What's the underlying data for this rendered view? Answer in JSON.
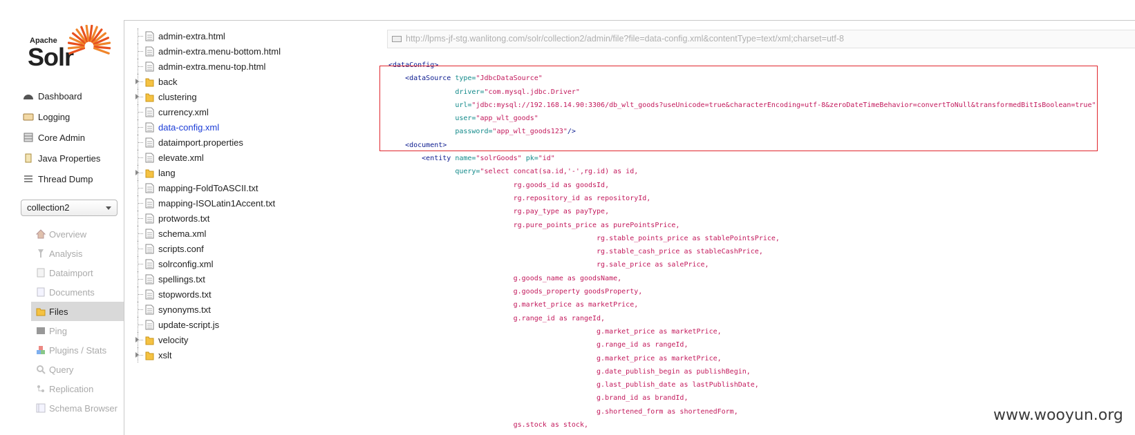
{
  "logo": {
    "apache": "Apache",
    "solr": "Solr"
  },
  "nav": [
    {
      "label": "Dashboard",
      "icon": "dashboard-icon"
    },
    {
      "label": "Logging",
      "icon": "logging-icon"
    },
    {
      "label": "Core Admin",
      "icon": "core-admin-icon"
    },
    {
      "label": "Java Properties",
      "icon": "java-properties-icon"
    },
    {
      "label": "Thread Dump",
      "icon": "thread-dump-icon"
    }
  ],
  "core_selector": {
    "value": "collection2"
  },
  "core_menu": [
    {
      "label": "Overview",
      "icon": "overview-icon"
    },
    {
      "label": "Analysis",
      "icon": "analysis-icon"
    },
    {
      "label": "Dataimport",
      "icon": "dataimport-icon"
    },
    {
      "label": "Documents",
      "icon": "documents-icon"
    },
    {
      "label": "Files",
      "icon": "files-icon",
      "active": true
    },
    {
      "label": "Ping",
      "icon": "ping-icon"
    },
    {
      "label": "Plugins / Stats",
      "icon": "plugins-icon"
    },
    {
      "label": "Query",
      "icon": "query-icon"
    },
    {
      "label": "Replication",
      "icon": "replication-icon"
    },
    {
      "label": "Schema Browser",
      "icon": "schema-browser-icon"
    }
  ],
  "files": [
    {
      "name": "admin-extra.html",
      "type": "file"
    },
    {
      "name": "admin-extra.menu-bottom.html",
      "type": "file"
    },
    {
      "name": "admin-extra.menu-top.html",
      "type": "file"
    },
    {
      "name": "back",
      "type": "folder"
    },
    {
      "name": "clustering",
      "type": "folder"
    },
    {
      "name": "currency.xml",
      "type": "file"
    },
    {
      "name": "data-config.xml",
      "type": "file",
      "selected": true
    },
    {
      "name": "dataimport.properties",
      "type": "file"
    },
    {
      "name": "elevate.xml",
      "type": "file"
    },
    {
      "name": "lang",
      "type": "folder"
    },
    {
      "name": "mapping-FoldToASCII.txt",
      "type": "file"
    },
    {
      "name": "mapping-ISOLatin1Accent.txt",
      "type": "file"
    },
    {
      "name": "protwords.txt",
      "type": "file"
    },
    {
      "name": "schema.xml",
      "type": "file"
    },
    {
      "name": "scripts.conf",
      "type": "file"
    },
    {
      "name": "solrconfig.xml",
      "type": "file"
    },
    {
      "name": "spellings.txt",
      "type": "file"
    },
    {
      "name": "stopwords.txt",
      "type": "file"
    },
    {
      "name": "synonyms.txt",
      "type": "file"
    },
    {
      "name": "update-script.js",
      "type": "file"
    },
    {
      "name": "velocity",
      "type": "folder"
    },
    {
      "name": "xslt",
      "type": "folder"
    }
  ],
  "url": "http://lpms-jf-stg.wanlitong.com/solr/collection2/admin/file?file=data-config.xml&contentType=text/xml;charset=utf-8",
  "code_lines": [
    [
      {
        "t": "tag",
        "v": "<dataConfig>"
      }
    ],
    [
      {
        "t": "tag",
        "v": "    <dataSource "
      },
      {
        "t": "attr",
        "v": "type="
      },
      {
        "t": "val",
        "v": "\"JdbcDataSource\""
      }
    ],
    [
      {
        "t": "attr",
        "v": "                driver="
      },
      {
        "t": "val",
        "v": "\"com.mysql.jdbc.Driver\""
      }
    ],
    [
      {
        "t": "attr",
        "v": "                url="
      },
      {
        "t": "val",
        "v": "\"jdbc:mysql://192.168.14.90:3306/db_wlt_goods?useUnicode=true&characterEncoding=utf-8&zeroDateTimeBehavior=convertToNull&transformedBitIsBoolean=true\""
      }
    ],
    [
      {
        "t": "attr",
        "v": "                user="
      },
      {
        "t": "val",
        "v": "\"app_wlt_goods\""
      }
    ],
    [
      {
        "t": "attr",
        "v": "                password="
      },
      {
        "t": "val",
        "v": "\"app_wlt_goods123\""
      },
      {
        "t": "tag",
        "v": "/>"
      }
    ],
    [
      {
        "t": "tag",
        "v": "    <document>"
      }
    ],
    [
      {
        "t": "tag",
        "v": "        <entity "
      },
      {
        "t": "attr",
        "v": "name="
      },
      {
        "t": "val",
        "v": "\"solrGoods\" "
      },
      {
        "t": "attr",
        "v": "pk="
      },
      {
        "t": "val",
        "v": "\"id\""
      }
    ],
    [
      {
        "t": "attr",
        "v": "                query="
      },
      {
        "t": "val",
        "v": "\"select concat(sa.id,'-',rg.id) as id,"
      }
    ],
    [
      {
        "t": "txt",
        "v": "                              rg.goods_id as goodsId,"
      }
    ],
    [
      {
        "t": "txt",
        "v": "                              rg.repository_id as repositoryId,"
      }
    ],
    [
      {
        "t": "txt",
        "v": "                              rg.pay_type as payType,"
      }
    ],
    [
      {
        "t": "txt",
        "v": "                              rg.pure_points_price as purePointsPrice,"
      }
    ],
    [
      {
        "t": "txt",
        "v": "                                                  rg.stable_points_price as stablePointsPrice,"
      }
    ],
    [
      {
        "t": "txt",
        "v": "                                                  rg.stable_cash_price as stableCashPrice,"
      }
    ],
    [
      {
        "t": "txt",
        "v": "                                                  rg.sale_price as salePrice,"
      }
    ],
    [
      {
        "t": "txt",
        "v": "                              g.goods_name as goodsName,"
      }
    ],
    [
      {
        "t": "txt",
        "v": "                              g.goods_property goodsProperty,"
      }
    ],
    [
      {
        "t": "txt",
        "v": "                              g.market_price as marketPrice,"
      }
    ],
    [
      {
        "t": "txt",
        "v": "                              g.range_id as rangeId,"
      }
    ],
    [
      {
        "t": "txt",
        "v": "                                                  g.market_price as marketPrice,"
      }
    ],
    [
      {
        "t": "txt",
        "v": "                                                  g.range_id as rangeId,"
      }
    ],
    [
      {
        "t": "txt",
        "v": "                                                  g.market_price as marketPrice,"
      }
    ],
    [
      {
        "t": "txt",
        "v": "                                                  g.date_publish_begin as publishBegin,"
      }
    ],
    [
      {
        "t": "txt",
        "v": "                                                  g.last_publish_date as lastPublishDate,"
      }
    ],
    [
      {
        "t": "txt",
        "v": "                                                  g.brand_id as brandId,"
      }
    ],
    [
      {
        "t": "txt",
        "v": "                                                  g.shortened_form as shortenedForm,"
      }
    ],
    [
      {
        "t": "txt",
        "v": "                              gs.stock as stock,"
      }
    ]
  ],
  "watermark": "www.wooyun.org",
  "colors": {
    "selected_file": "#1b3cd7",
    "highlight_box": "#e0242b",
    "xml_tag": "#0b1b8f",
    "xml_attr": "#138a8a",
    "xml_value": "#c2185b"
  }
}
